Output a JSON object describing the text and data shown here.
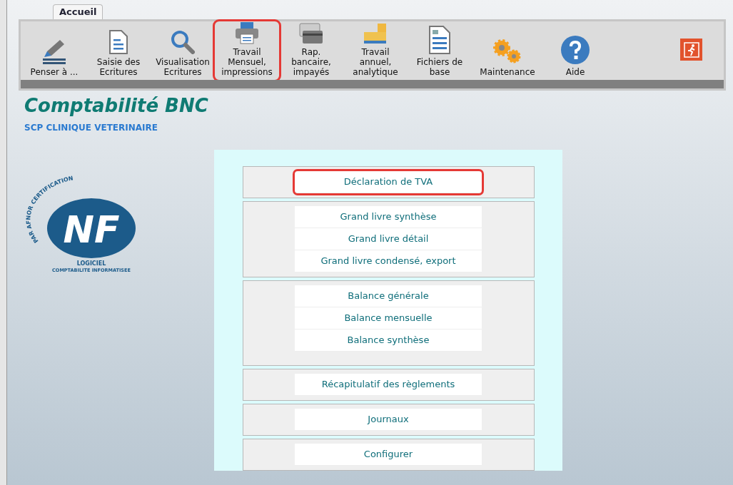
{
  "tabs": [
    {
      "label": "Accueil",
      "selected": true
    }
  ],
  "toolbar": [
    {
      "kind": "pen",
      "label": "Penser à ...",
      "highlighted": false
    },
    {
      "kind": "document",
      "label": "Saisie des Ecritures",
      "highlighted": false
    },
    {
      "kind": "search",
      "label": "Visualisation Ecritures",
      "highlighted": false
    },
    {
      "kind": "printer",
      "label": "Travail Mensuel, impressions",
      "highlighted": true
    },
    {
      "kind": "cards",
      "label": "Rap. bancaire, impayés",
      "highlighted": false
    },
    {
      "kind": "boxes",
      "label": "Travail annuel, analytique",
      "highlighted": false
    },
    {
      "kind": "file",
      "label": "Fichiers de base",
      "highlighted": false
    },
    {
      "kind": "gears",
      "label": "Maintenance",
      "highlighted": false
    },
    {
      "kind": "help",
      "label": "Aide",
      "highlighted": false
    }
  ],
  "app_title": "Comptabilité BNC",
  "company": "SCP CLINIQUE VETERINAIRE",
  "logo": {
    "arc": "PAR AFNOR CERTIFICATION",
    "mark": "NF",
    "line_1": "LOGICIEL",
    "line_2": "COMPTABILITE INFORMATISEE"
  },
  "menu_groups": [
    {
      "items": [
        {
          "label": "Déclaration de TVA",
          "highlighted": true
        }
      ]
    },
    {
      "items": [
        {
          "label": "Grand livre synthèse",
          "highlighted": false
        },
        {
          "label": "Grand livre détail",
          "highlighted": false
        },
        {
          "label": "Grand livre condensé, export",
          "highlighted": false
        }
      ]
    },
    {
      "tall": true,
      "items": [
        {
          "label": "Balance générale",
          "highlighted": false
        },
        {
          "label": "Balance mensuelle",
          "highlighted": false
        },
        {
          "label": "Balance synthèse",
          "highlighted": false
        }
      ]
    },
    {
      "items": [
        {
          "label": "Récapitulatif des règlements",
          "highlighted": false
        }
      ]
    },
    {
      "items": [
        {
          "label": "Journaux",
          "highlighted": false
        }
      ]
    },
    {
      "items": [
        {
          "label": "Configurer",
          "highlighted": false
        }
      ]
    }
  ]
}
